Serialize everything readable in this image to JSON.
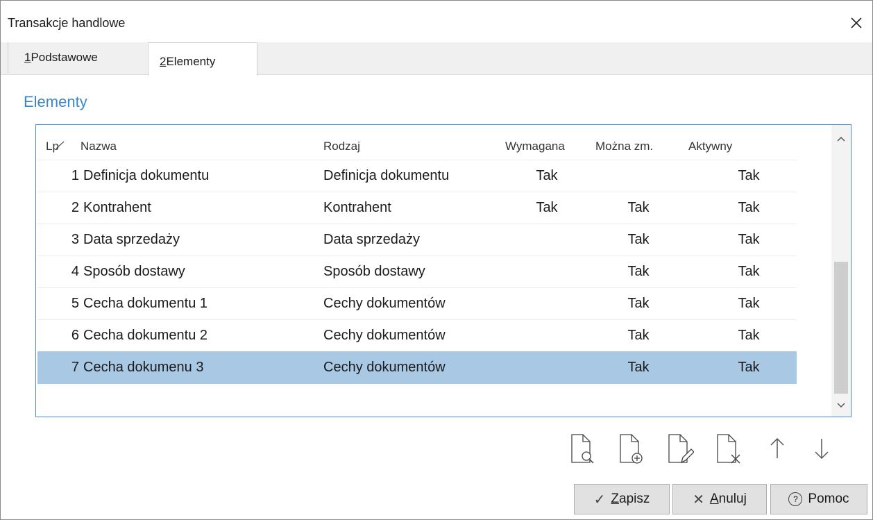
{
  "window": {
    "title": "Transakcje handlowe",
    "close_glyph": "✕"
  },
  "tabs": [
    {
      "hotkey": "1",
      "label": " Podstawowe",
      "active": false
    },
    {
      "hotkey": "2",
      "label": " Elementy",
      "active": true
    }
  ],
  "section": {
    "title": "Elementy"
  },
  "grid": {
    "columns": {
      "lp": "Lp",
      "name": "Nazwa",
      "kind": "Rodzaj",
      "required": "Wymagana",
      "changeable": "Można zm.",
      "active": "Aktywny"
    },
    "rows": [
      {
        "lp": "1",
        "name": "Definicja dokumentu",
        "kind": "Definicja dokumentu",
        "required": "Tak",
        "changeable": "",
        "active": "Tak"
      },
      {
        "lp": "2",
        "name": "Kontrahent",
        "kind": "Kontrahent",
        "required": "Tak",
        "changeable": "Tak",
        "active": "Tak"
      },
      {
        "lp": "3",
        "name": "Data sprzedaży",
        "kind": "Data sprzedaży",
        "required": "",
        "changeable": "Tak",
        "active": "Tak"
      },
      {
        "lp": "4",
        "name": "Sposób dostawy",
        "kind": "Sposób dostawy",
        "required": "",
        "changeable": "Tak",
        "active": "Tak"
      },
      {
        "lp": "5",
        "name": "Cecha dokumentu 1",
        "kind": "Cechy dokumentów",
        "required": "",
        "changeable": "Tak",
        "active": "Tak"
      },
      {
        "lp": "6",
        "name": "Cecha dokumentu 2",
        "kind": "Cechy dokumentów",
        "required": "",
        "changeable": "Tak",
        "active": "Tak"
      },
      {
        "lp": "7",
        "name": "Cecha dokumenu 3",
        "kind": "Cechy dokumentów",
        "required": "",
        "changeable": "Tak",
        "active": "Tak"
      }
    ],
    "selected_row": "7"
  },
  "toolbar": {
    "icons": [
      "view-document-icon",
      "add-document-icon",
      "edit-document-icon",
      "delete-document-icon",
      "move-up-icon",
      "move-down-icon"
    ]
  },
  "buttons": {
    "save": {
      "icon": "✓",
      "hotkey": "Z",
      "rest": "apisz"
    },
    "cancel": {
      "icon": "✕",
      "hotkey": "A",
      "rest": "nuluj"
    },
    "help": {
      "icon": "?",
      "label": "Pomoc"
    }
  },
  "colors": {
    "accent": "#3a86c8",
    "selection": "#a8c8e4",
    "grid_border": "#3c8dde"
  }
}
